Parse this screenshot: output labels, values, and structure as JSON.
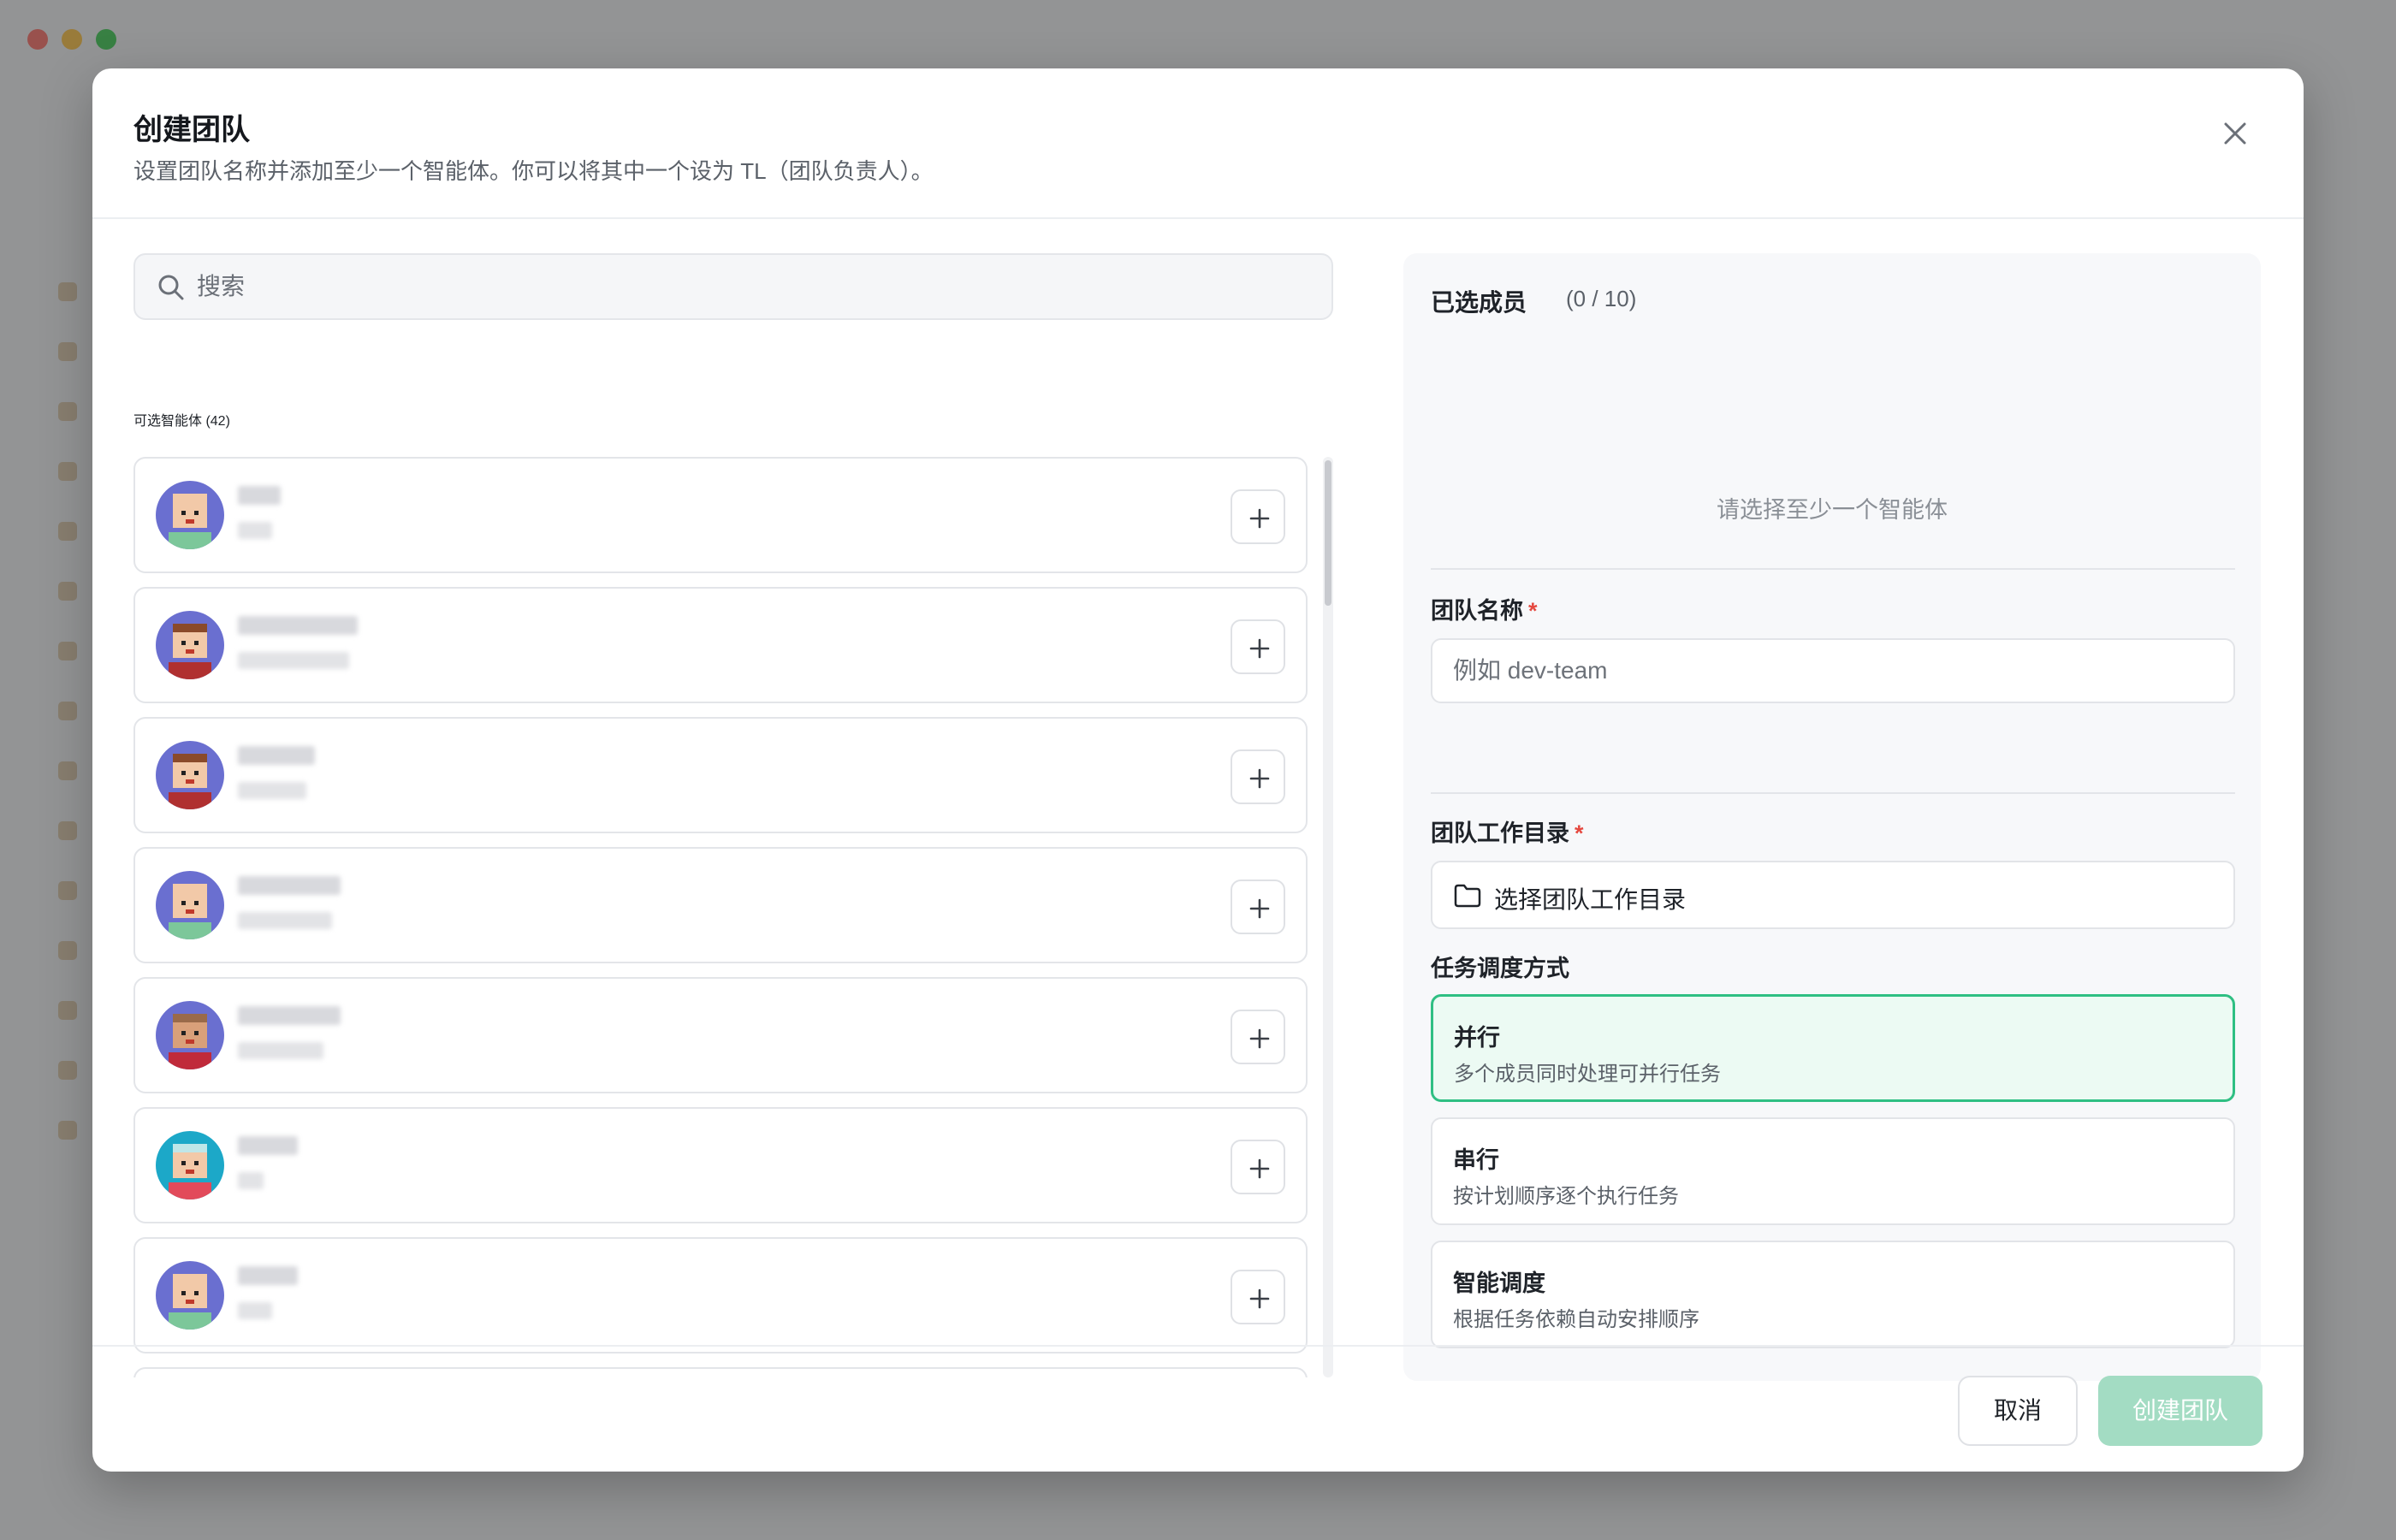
{
  "dialog": {
    "title": "创建团队",
    "subtitle": "设置团队名称并添加至少一个智能体。你可以将其中一个设为 TL（团队负责人）。"
  },
  "search": {
    "placeholder": "搜索"
  },
  "available": {
    "label": "可选智能体 (42)",
    "agents": [
      {
        "avatar": "agent-avatar-bald",
        "skin": "#f2c9a8",
        "hair": "#f2c9a8",
        "shirt": "#7cc79a",
        "bg": "#6a6fd0"
      },
      {
        "avatar": "agent-avatar-brown-hair",
        "skin": "#f2c9a8",
        "hair": "#8a4a2a",
        "shirt": "#b03030",
        "bg": "#6a6fd0"
      },
      {
        "avatar": "agent-avatar-brown-hair",
        "skin": "#f2c9a8",
        "hair": "#8a4a2a",
        "shirt": "#b03030",
        "bg": "#6a6fd0"
      },
      {
        "avatar": "agent-avatar-bald",
        "skin": "#f2c9a8",
        "hair": "#f2c9a8",
        "shirt": "#7cc79a",
        "bg": "#6a6fd0"
      },
      {
        "avatar": "agent-avatar-tan",
        "skin": "#d9a07a",
        "hair": "#9a6a4a",
        "shirt": "#c02a3a",
        "bg": "#6a6fd0"
      },
      {
        "avatar": "agent-avatar-teal",
        "skin": "#f2c9a8",
        "hair": "#bfe6e8",
        "shirt": "#e24a5a",
        "bg": "#1ca8c8"
      },
      {
        "avatar": "agent-avatar-bald",
        "skin": "#f2c9a8",
        "hair": "#f2c9a8",
        "shirt": "#7cc79a",
        "bg": "#6a6fd0"
      }
    ]
  },
  "selected": {
    "title": "已选成员",
    "count": "(0 / 10)",
    "empty": "请选择至少一个智能体"
  },
  "team_name": {
    "label": "团队名称",
    "required": "*",
    "placeholder": "例如 dev-team"
  },
  "work_dir": {
    "label": "团队工作目录",
    "required": "*",
    "button_label": "选择团队工作目录"
  },
  "schedule": {
    "label": "任务调度方式",
    "options": [
      {
        "title": "并行",
        "desc": "多个成员同时处理可并行任务",
        "selected": true
      },
      {
        "title": "串行",
        "desc": "按计划顺序逐个执行任务",
        "selected": false
      },
      {
        "title": "智能调度",
        "desc": "根据任务依赖自动安排顺序",
        "selected": false
      }
    ]
  },
  "footer": {
    "cancel": "取消",
    "create": "创建团队"
  },
  "colors": {
    "accent": "#2fbf83",
    "accent_disabled": "#a3dcc3",
    "required": "#e5483f"
  }
}
